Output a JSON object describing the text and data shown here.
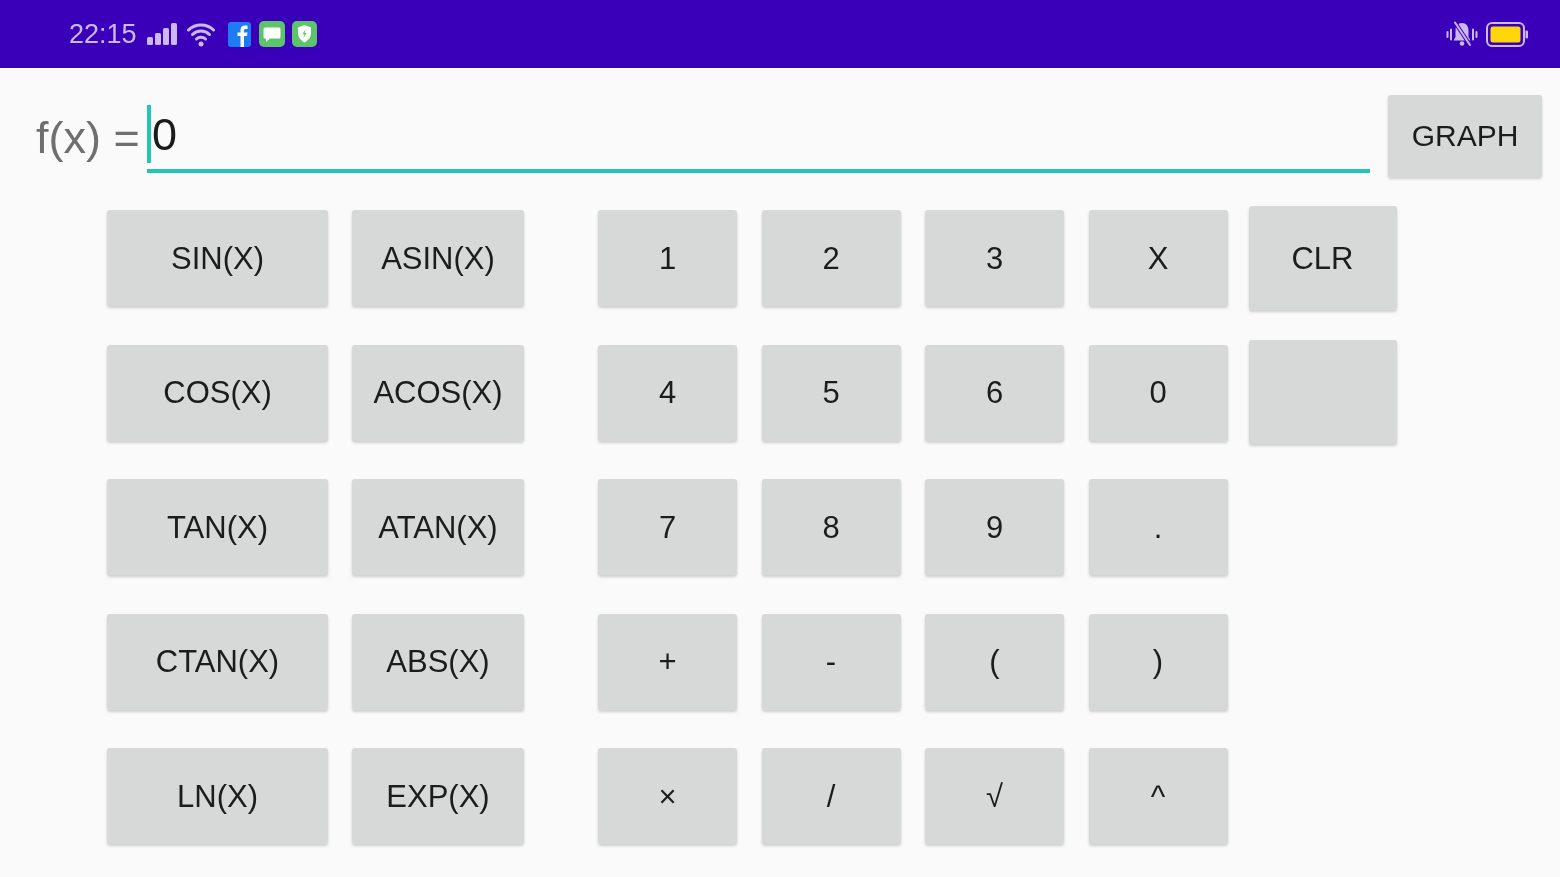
{
  "status_bar": {
    "time": "22:15"
  },
  "expression": {
    "label": "f(x) =",
    "value": "0",
    "focused": true
  },
  "graph_button": {
    "label": "GRAPH"
  },
  "function_keys": [
    "SIN(X)",
    "ASIN(X)",
    "COS(X)",
    "ACOS(X)",
    "TAN(X)",
    "ATAN(X)",
    "CTAN(X)",
    "ABS(X)",
    "LN(X)",
    "EXP(X)"
  ],
  "number_keys": [
    "1",
    "2",
    "3",
    "X",
    "4",
    "5",
    "6",
    "0",
    "7",
    "8",
    "9",
    ".",
    "+",
    "-",
    "(",
    ")",
    "×",
    "/",
    "√",
    "^"
  ],
  "side_keys": [
    {
      "kind": "label",
      "label": "CLR"
    },
    {
      "kind": "blank"
    }
  ]
}
